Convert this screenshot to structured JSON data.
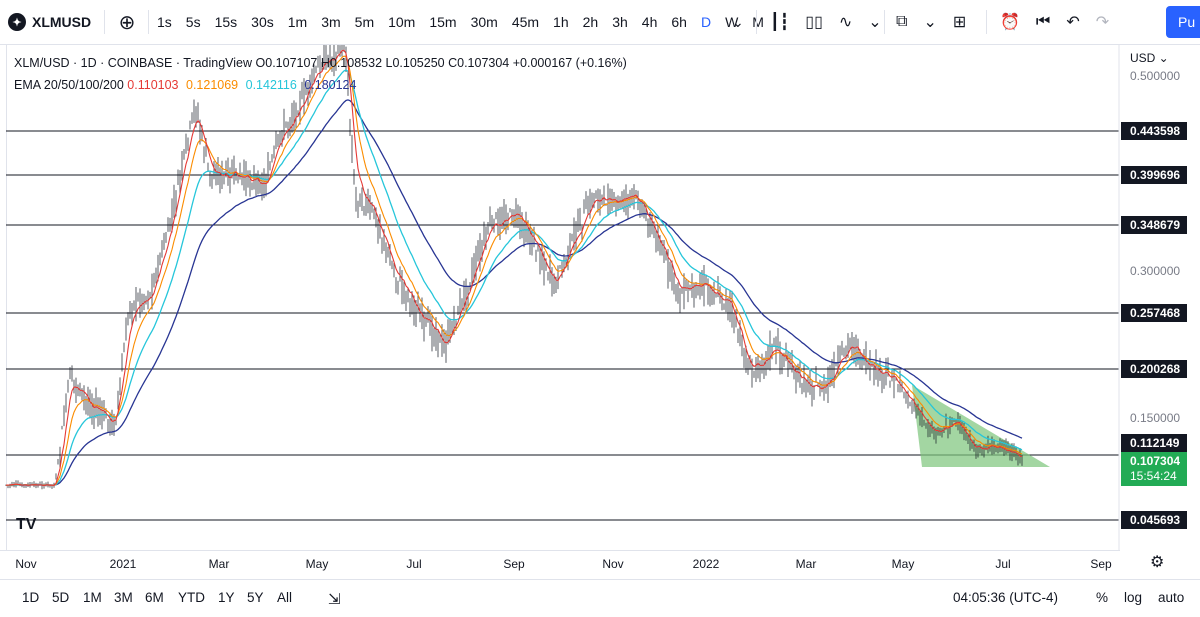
{
  "toolbar": {
    "symbol": "XLMUSD",
    "symbol_icon": "stellar-logo-icon",
    "add_icon": "plus-circle-icon",
    "intervals": [
      "1s",
      "5s",
      "15s",
      "30s",
      "1m",
      "3m",
      "5m",
      "10m",
      "15m",
      "30m",
      "45m",
      "1h",
      "2h",
      "3h",
      "4h",
      "6h",
      "D",
      "W",
      "M"
    ],
    "active_interval": "D",
    "interval_menu_icon": "chevron-down-icon",
    "chart_type_icons": [
      "candles-icon",
      "bars-icon",
      "line-icon",
      "chevron-down-icon"
    ],
    "indicator_icons": [
      "indicators-icon",
      "chevron-down-icon",
      "layout-grid-icon"
    ],
    "action_icons": [
      "alert-clock-icon",
      "replay-icon",
      "undo-icon",
      "redo-icon"
    ],
    "publish_label": "Pu"
  },
  "legend": {
    "title": "XLM/USD · 1D · COINBASE · TradingView",
    "open": "O0.107107",
    "high": "H0.108532",
    "low": "L0.105250",
    "close": "C0.107304",
    "change": "+0.000167 (+0.16%)",
    "ema_label": "EMA 20/50/100/200",
    "ema_values": [
      {
        "value": "0.110103",
        "color": "#e53935"
      },
      {
        "value": "0.121069",
        "color": "#fb8c00"
      },
      {
        "value": "0.142116",
        "color": "#26c6da"
      },
      {
        "value": "0.180124",
        "color": "#283593"
      }
    ]
  },
  "price_axis": {
    "currency": "USD",
    "currency_icon": "chevron-down-icon",
    "labels": [
      "0.500000",
      "0.300000",
      "0.150000"
    ],
    "level_tags": [
      "0.443598",
      "0.399696",
      "0.348679",
      "0.257468",
      "0.200268",
      "0.112149",
      "0.045693"
    ],
    "last_price": "0.107304",
    "countdown": "15:54:24"
  },
  "time_axis": {
    "labels": [
      "Nov",
      "2021",
      "Mar",
      "May",
      "Jul",
      "Sep",
      "Nov",
      "2022",
      "Mar",
      "May",
      "Jul",
      "Sep"
    ],
    "settings_icon": "gear-icon"
  },
  "bottom_bar": {
    "ranges": [
      "1D",
      "5D",
      "1M",
      "3M",
      "6M",
      "YTD",
      "1Y",
      "5Y",
      "All"
    ],
    "compare_icon": "calendar-range-icon",
    "clock": "04:05:36 (UTC-4)",
    "percent": "%",
    "log": "log",
    "auto": "auto"
  },
  "logo": "TV",
  "colors": {
    "ema20": "#e53935",
    "ema50": "#fb8c00",
    "ema100": "#26c6da",
    "ema200": "#283593",
    "candles": "#131722",
    "triangle_fill": "#7cc47a",
    "level_lines": "#131722",
    "accent": "#2962ff"
  },
  "chart_data": {
    "type": "line",
    "title": "XLM/USD · 1D · COINBASE · TradingView",
    "x": [
      "Nov",
      "2021",
      "Mar",
      "May",
      "Jul",
      "Sep",
      "Nov",
      "2022",
      "Mar",
      "May",
      "Jul",
      "Sep"
    ],
    "series": [
      {
        "name": "EMA 20/50/100/200",
        "values": [
          0.08,
          0.12,
          0.38,
          0.45,
          0.3,
          0.34,
          0.37,
          0.31,
          0.22,
          0.17,
          0.11,
          0.11
        ]
      }
    ],
    "horizontal_levels": [
      0.443598,
      0.399696,
      0.348679,
      0.257468,
      0.200268,
      0.112149,
      0.045693
    ],
    "last_price": 0.107304,
    "ylim": [
      0.04,
      0.55
    ],
    "grid": false
  }
}
